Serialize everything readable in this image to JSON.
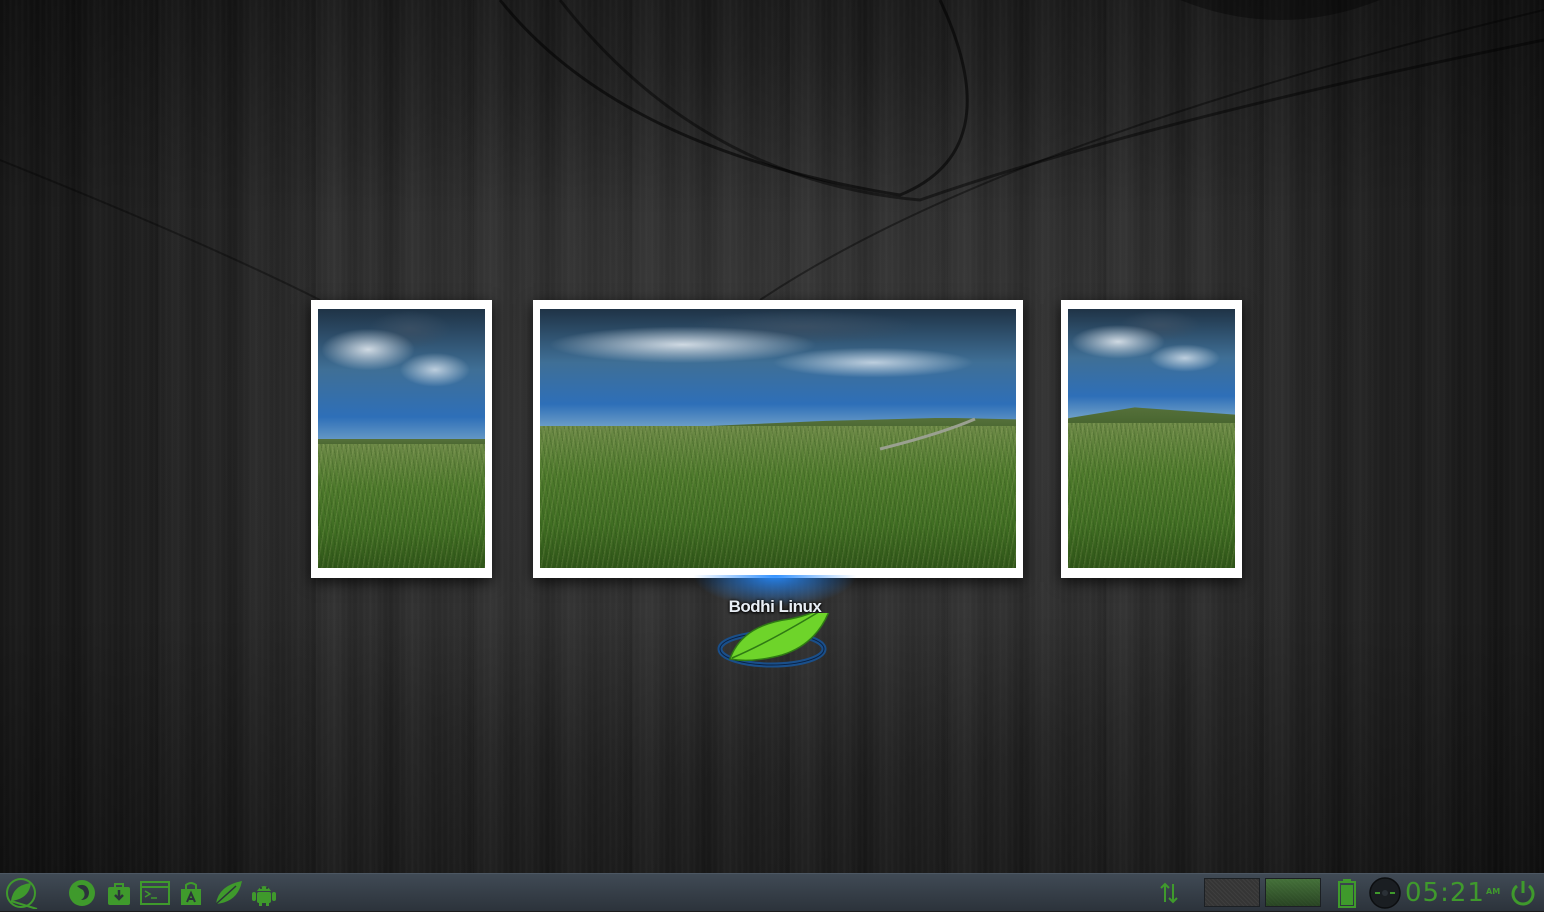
{
  "desktop": {
    "wallpaper": "dark wood panels",
    "logo_text": "Bodhi Linux",
    "accent_color": "#3f9a2c",
    "glow_color": "#2a8cff"
  },
  "taskbar": {
    "start_icon": "bodhi-leaf-icon",
    "launchers": [
      {
        "name": "browser-icon"
      },
      {
        "name": "software-store-icon"
      },
      {
        "name": "terminal-icon"
      },
      {
        "name": "file-manager-icon"
      },
      {
        "name": "leaf-icon"
      },
      {
        "name": "android-icon"
      }
    ],
    "network_icon": "network-transfer-icon",
    "pager_count": 2,
    "pager_active_index": 1,
    "battery_icon": "battery-icon",
    "clock": {
      "time": "05:21",
      "ampm": "AM"
    },
    "power_icon": "power-icon"
  }
}
